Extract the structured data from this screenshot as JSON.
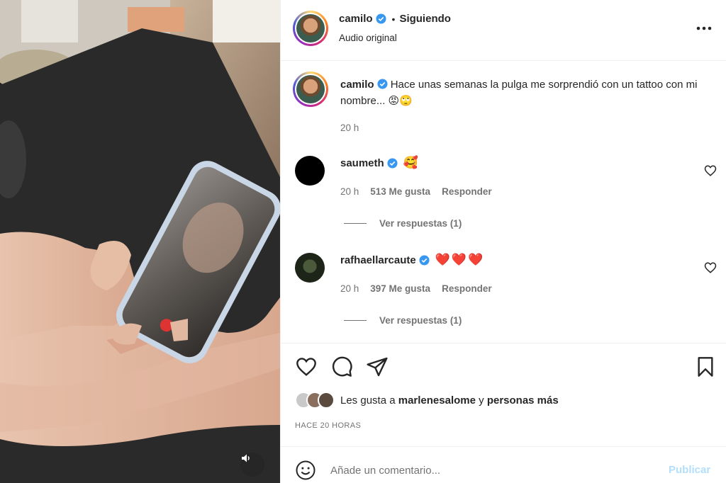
{
  "post": {
    "author": "camilo",
    "follow_separator": "•",
    "follow_status": "Siguiendo",
    "audio": "Audio original",
    "more_icon": "more-horizontal-icon"
  },
  "caption": {
    "author": "camilo",
    "text": "Hace unas semanas la pulga me sorprendió con un tattoo con mi nombre... 😡🙄",
    "time": "20 h"
  },
  "comments": [
    {
      "user": "saumeth",
      "emojis": "🥰",
      "time": "20 h",
      "likes": "513 Me gusta",
      "reply": "Responder",
      "view_replies": "Ver respuestas (1)"
    },
    {
      "user": "rafhaellarcaute",
      "emojis": "❤️❤️❤️",
      "time": "20 h",
      "likes": "397 Me gusta",
      "reply": "Responder",
      "view_replies": "Ver respuestas (1)"
    }
  ],
  "likes_line": {
    "prefix": "Les gusta a",
    "user": "marlenesalome",
    "joiner": "y",
    "others": "personas más"
  },
  "time_ago": "HACE 20 HORAS",
  "add_comment": {
    "placeholder": "Añade un comentario...",
    "publish": "Publicar"
  },
  "colors": {
    "verified": "#3897f0",
    "publish_disabled": "#b2dffc",
    "muted": "#737373"
  }
}
